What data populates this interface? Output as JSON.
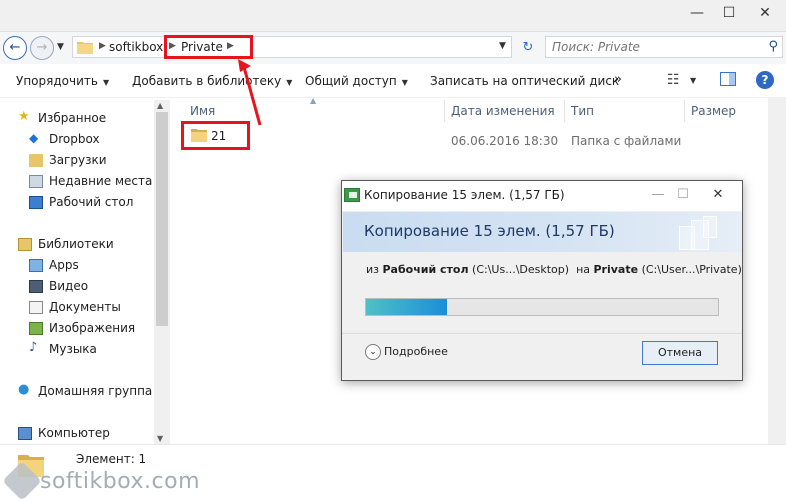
{
  "window": {
    "minimize_glyph": "—",
    "maximize_glyph": "☐",
    "close_glyph": "✕"
  },
  "address_bar": {
    "breadcrumbs": [
      "softikbox",
      "Private"
    ],
    "separator_glyph": "▶"
  },
  "search": {
    "placeholder": "Поиск: Private"
  },
  "toolbar": {
    "organize": "Упорядочить",
    "add_to_library": "Добавить в библиотеку",
    "share": "Общий доступ",
    "burn": "Записать на оптический диск",
    "more": "»",
    "help": "?"
  },
  "nav_pane": {
    "favorites": "Избранное",
    "dropbox": "Dropbox",
    "downloads": "Загрузки",
    "recent": "Недавние места",
    "desktop": "Рабочий стол",
    "libraries": "Библиотеки",
    "apps": "Apps",
    "video": "Видео",
    "documents": "Документы",
    "pictures": "Изображения",
    "music": "Музыка",
    "homegroup": "Домашняя группа",
    "computer": "Компьютер"
  },
  "columns": {
    "name": "Имя",
    "date": "Дата изменения",
    "type": "Тип",
    "size": "Размер"
  },
  "files": [
    {
      "name": "21",
      "date": "06.06.2016 18:30",
      "type": "Папка с файлами",
      "size": ""
    }
  ],
  "status": {
    "count": "Элемент: 1"
  },
  "watermark": {
    "text": "softikbox.com"
  },
  "copy_dialog": {
    "title": "Копирование 15 элем. (1,57 ГБ)",
    "header": "Копирование 15 элем. (1,57 ГБ)",
    "from_word": "из",
    "from_name": "Рабочий стол",
    "from_path": "(C:\\Us...\\Desktop)",
    "to_word": "на",
    "to_name": "Private",
    "to_path": "(C:\\User...\\Private)",
    "progress_fraction": 0.23,
    "more_details": "Подробнее",
    "cancel": "Отмена"
  },
  "colors": {
    "highlight": "#e8141d",
    "accent": "#2d68c4",
    "progress_start": "#4fc0c7",
    "progress_end": "#1c8ed8"
  }
}
